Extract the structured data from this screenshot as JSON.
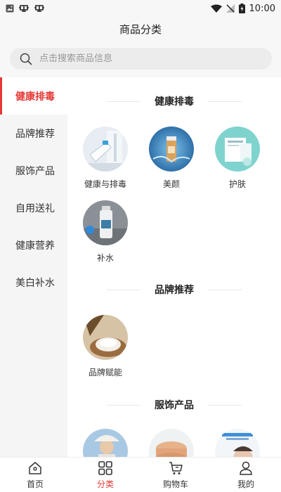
{
  "status_bar": {
    "time": "10:00"
  },
  "header": {
    "title": "商品分类"
  },
  "search": {
    "placeholder": "点击搜索商品信息"
  },
  "sidebar": {
    "items": [
      {
        "label": "健康排毒",
        "active": true
      },
      {
        "label": "品牌推荐",
        "active": false
      },
      {
        "label": "服饰产品",
        "active": false
      },
      {
        "label": "自用送礼",
        "active": false
      },
      {
        "label": "健康营养",
        "active": false
      },
      {
        "label": "美白补水",
        "active": false
      }
    ]
  },
  "sections": [
    {
      "title": "健康排毒",
      "items": [
        {
          "label": "健康与排毒"
        },
        {
          "label": "美颜"
        },
        {
          "label": "护肤"
        },
        {
          "label": "补水"
        }
      ]
    },
    {
      "title": "品牌推荐",
      "items": [
        {
          "label": "品牌赋能"
        }
      ]
    },
    {
      "title": "服饰产品",
      "items": []
    }
  ],
  "tabbar": {
    "items": [
      {
        "label": "首页",
        "icon": "home-icon"
      },
      {
        "label": "分类",
        "icon": "category-icon",
        "active": true
      },
      {
        "label": "购物车",
        "icon": "cart-icon"
      },
      {
        "label": "我的",
        "icon": "profile-icon"
      }
    ]
  },
  "colors": {
    "accent": "#e53935",
    "sidebar_bg": "#f5f5f5",
    "page_bg": "#f7f7f7"
  }
}
